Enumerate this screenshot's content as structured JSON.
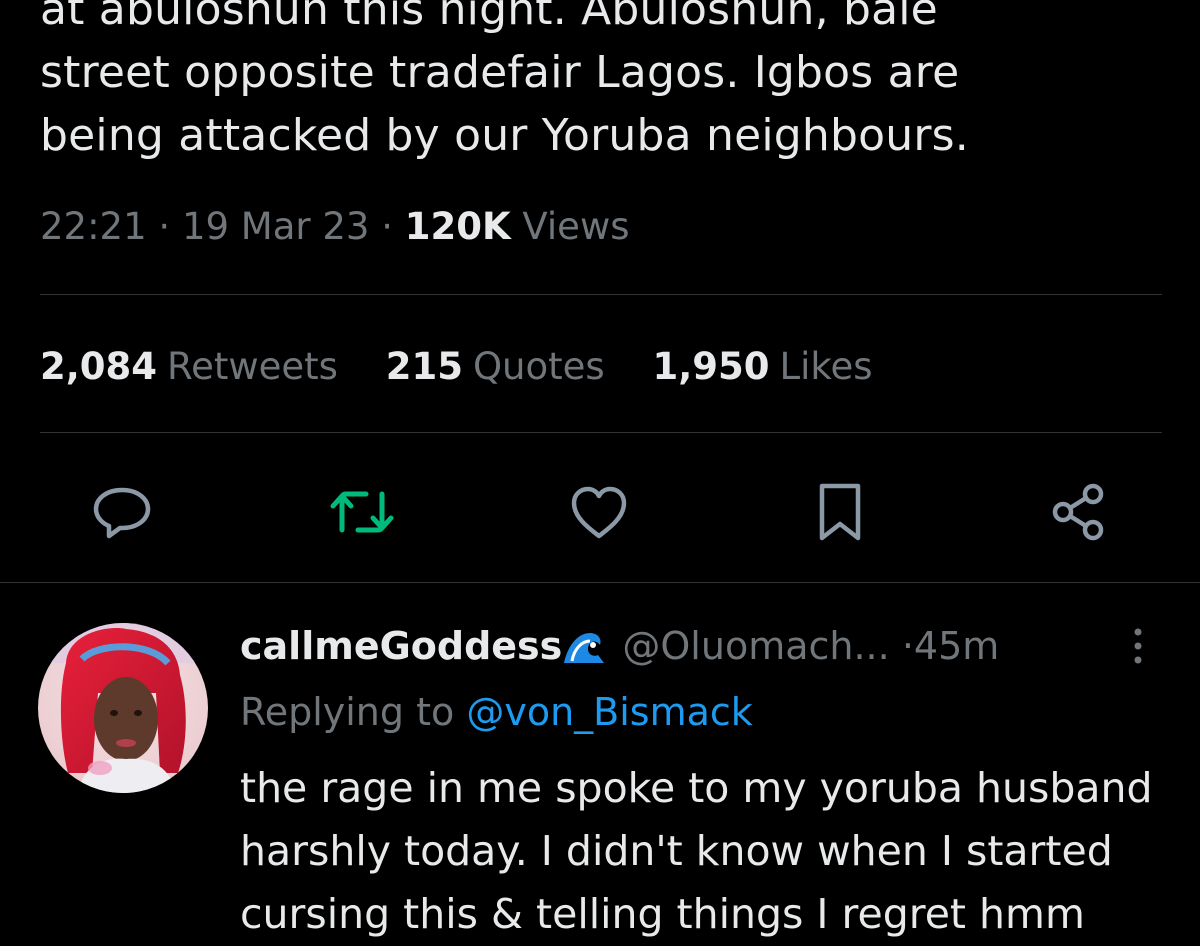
{
  "tweet": {
    "text_lines": [
      "at abuloshun this night. Abuloshun, bale",
      "street opposite tradefair Lagos. Igbos are",
      "being attacked by our Yoruba neighbours."
    ],
    "time": "22:21",
    "date": "19 Mar 23",
    "views_count": "120K",
    "views_label": "Views",
    "separator": "·"
  },
  "stats": {
    "retweets": {
      "count": "2,084",
      "label": "Retweets"
    },
    "quotes": {
      "count": "215",
      "label": "Quotes"
    },
    "likes": {
      "count": "1,950",
      "label": "Likes"
    }
  },
  "actions": {
    "reply_icon": "speech-bubble-icon",
    "retweet_icon": "retweet-icon",
    "like_icon": "heart-icon",
    "bookmark_icon": "bookmark-icon",
    "share_icon": "share-icon",
    "retweet_color": "#00ba7c"
  },
  "reply": {
    "display_name": "callmeGoddess",
    "handle": "@Oluomach...",
    "time": "45m",
    "separator": "·",
    "replying_prefix": "Replying to",
    "replying_handle": "@von_Bismack",
    "text_lines": [
      "the rage in me spoke to my yoruba husband",
      "harshly today. I didn't know when I started",
      "cursing this & telling things I regret hmm"
    ]
  },
  "colors": {
    "background": "#000000",
    "text_primary": "#e7e9ea",
    "text_secondary": "#71767b",
    "link": "#1d9bf0",
    "divider": "#2f3336"
  }
}
